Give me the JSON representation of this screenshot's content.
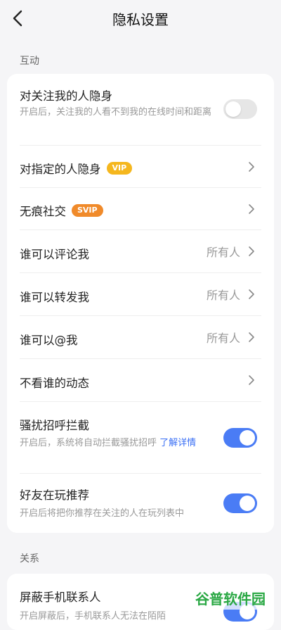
{
  "header": {
    "title": "隐私设置"
  },
  "sections": [
    {
      "label": "互动",
      "rows": [
        {
          "title": "对关注我的人隐身",
          "subtitle": "开启后，关注我的人看不到我的在线时间和距离",
          "toggle": false
        },
        {
          "title": "对指定的人隐身",
          "badge": "VIP"
        },
        {
          "title": "无痕社交",
          "badge": "SVIP"
        },
        {
          "title": "谁可以评论我",
          "value": "所有人"
        },
        {
          "title": "谁可以转发我",
          "value": "所有人"
        },
        {
          "title": "谁可以@我",
          "value": "所有人"
        },
        {
          "title": "不看谁的动态"
        },
        {
          "title": "骚扰招呼拦截",
          "subtitle": "开启后，系统将自动拦截骚扰招呼",
          "link": "了解详情",
          "toggle": true
        },
        {
          "title": "好友在玩推荐",
          "subtitle": "开启后将把你推荐在关注的人在玩列表中",
          "toggle": true
        }
      ]
    },
    {
      "label": "关系",
      "rows": [
        {
          "title": "屏蔽手机联系人",
          "subtitle": "开启屏蔽后，手机联系人无法在陌陌",
          "toggle": true
        }
      ]
    }
  ],
  "colors": {
    "accent": "#4a7cf5",
    "vip": "#f5b71e",
    "svip": "#f08a2a"
  },
  "icons": {
    "back": "chevron-left-icon",
    "row_arrow": "chevron-right-icon"
  },
  "watermark": "谷普软件园"
}
